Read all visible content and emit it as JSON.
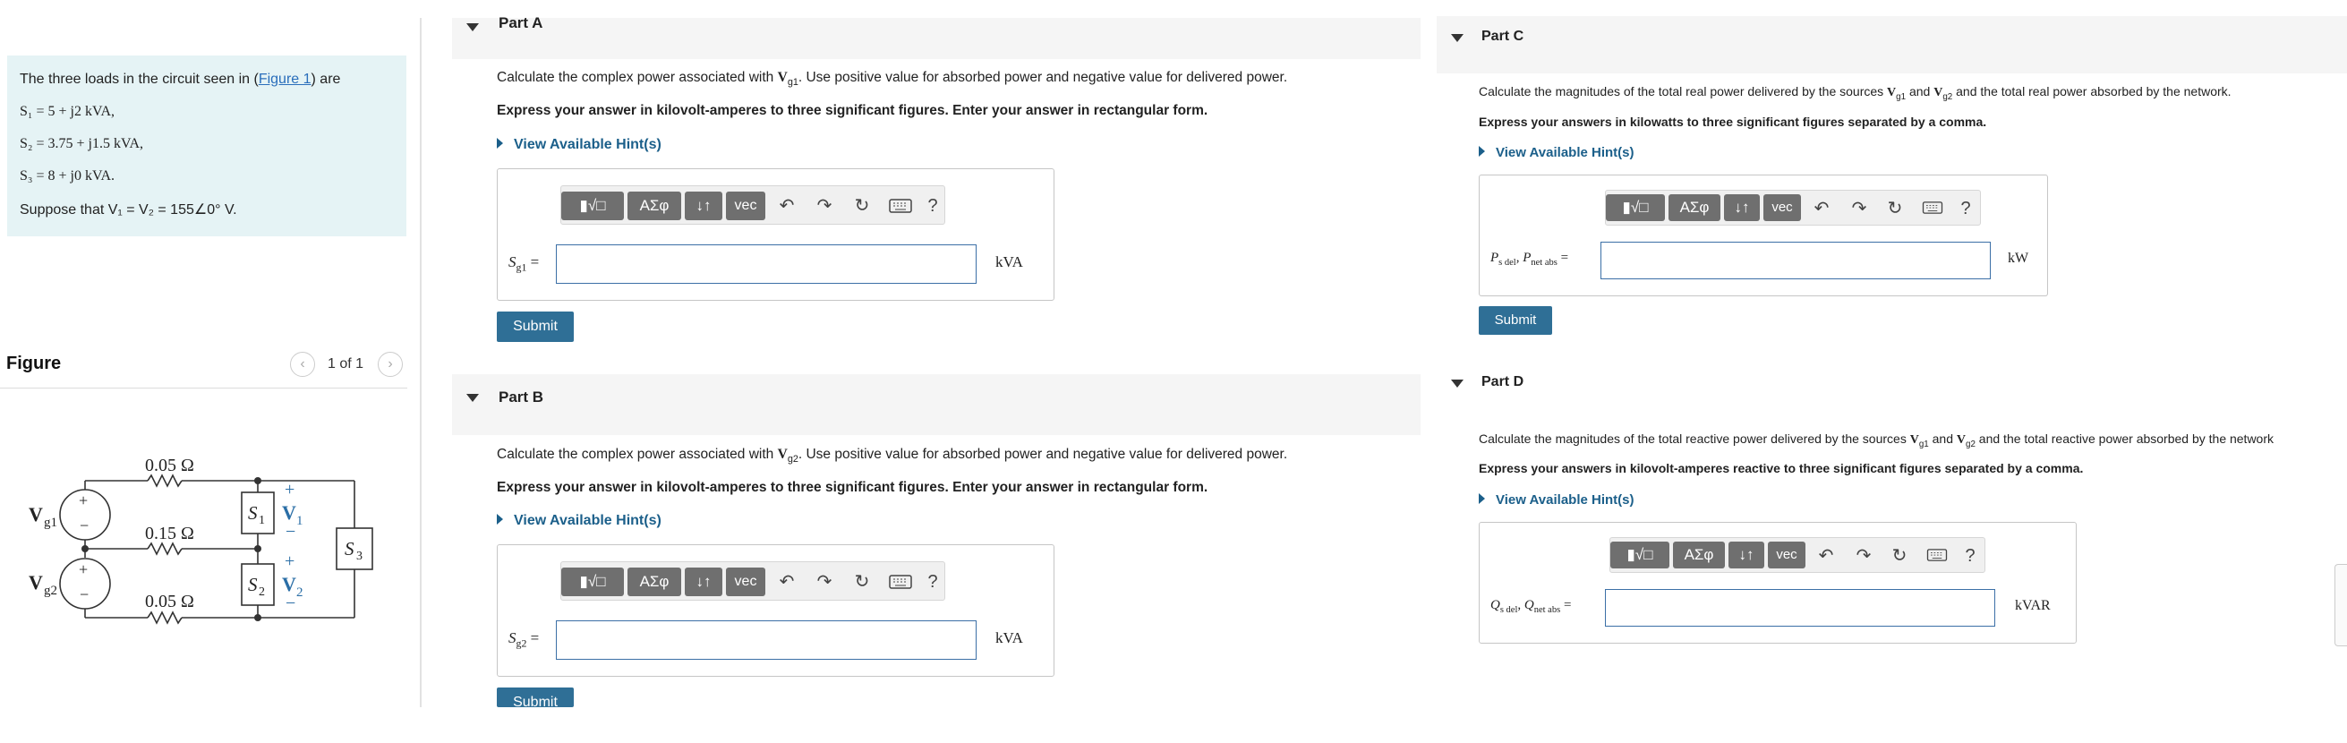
{
  "problem": {
    "intro_prefix": "The three loads in the circuit seen in (",
    "figure_link": "Figure 1",
    "intro_suffix": ") are",
    "s1": "S₁ = 5 + j2 kVA,",
    "s2": "S₂ = 3.75 + j1.5 kVA,",
    "s3": "S₃ = 8 + j0 kVA.",
    "suppose": "Suppose that V₁ = V₂ = 155∠0° V."
  },
  "figure": {
    "title": "Figure",
    "pager": "1 of 1",
    "prev_icon": "chevron-left-icon",
    "next_icon": "chevron-right-icon",
    "circuit": {
      "r_top": "0.05 Ω",
      "r_mid": "0.15 Ω",
      "r_bot": "0.05 Ω",
      "vg1": "V",
      "vg1_sub": "g1",
      "vg2": "V",
      "vg2_sub": "g2",
      "s1": "S",
      "s1_sub": "1",
      "s2": "S",
      "s2_sub": "2",
      "s3": "S",
      "s3_sub": "3",
      "v1": "V",
      "v1_sub": "1",
      "v2": "V",
      "v2_sub": "2",
      "plus": "+",
      "minus": "−"
    }
  },
  "toolbar": {
    "template_icon": "fraction-root-template-icon",
    "greek": "AΣφ",
    "arrows": "↓↑",
    "vec": "vec",
    "undo_icon": "↶",
    "redo_icon": "↷",
    "reset_icon": "↻",
    "keyboard_icon": "keyboard-icon",
    "help": "?"
  },
  "partA": {
    "title": "Part A",
    "q_prefix": "Calculate the complex power associated with ",
    "q_var": "V",
    "q_sub": "g1",
    "q_suffix": ". Use positive value for absorbed power and negative value for delivered power.",
    "instruction": "Express your answer in kilovolt-amperes to three significant figures. Enter your answer in rectangular form.",
    "hint": "View Available Hint(s)",
    "label": "S",
    "label_sub": "g1",
    "label_eq": " =",
    "unit": "kVA",
    "input_value": "",
    "submit": "Submit"
  },
  "partB": {
    "title": "Part B",
    "q_prefix": "Calculate the complex power associated with ",
    "q_var": "V",
    "q_sub": "g2",
    "q_suffix": ". Use positive value for absorbed power and negative value for delivered power.",
    "instruction": "Express your answer in kilovolt-amperes to three significant figures. Enter your answer in rectangular form.",
    "hint": "View Available Hint(s)",
    "label": "S",
    "label_sub": "g2",
    "label_eq": " =",
    "unit": "kVA",
    "input_value": "",
    "submit": "Submit"
  },
  "partC": {
    "title": "Part C",
    "q_prefix": "Calculate the magnitudes of the total real power delivered by the sources ",
    "q_v1": "V",
    "q_v1_sub": "g1",
    "q_and": " and ",
    "q_v2": "V",
    "q_v2_sub": "g2",
    "q_suffix": " and the total real power absorbed by the network.",
    "instruction": "Express your answers in kilowatts to three significant figures separated by a comma.",
    "hint": "View Available Hint(s)",
    "label_a": "P",
    "label_a_sub": "s del",
    "label_b": "P",
    "label_b_sub": "net abs",
    "label_eq": " =",
    "unit": "kW",
    "input_value": "",
    "submit": "Submit"
  },
  "partD": {
    "title": "Part D",
    "q_prefix": "Calculate the magnitudes of the total reactive power delivered by the sources ",
    "q_v1": "V",
    "q_v1_sub": "g1",
    "q_and": " and ",
    "q_v2": "V",
    "q_v2_sub": "g2",
    "q_suffix": " and the total reactive power absorbed by the network",
    "instruction": "Express your answers in kilovolt-amperes reactive to three significant figures separated by a comma.",
    "hint": "View Available Hint(s)",
    "label_a": "Q",
    "label_a_sub": "s del",
    "label_b": "Q",
    "label_b_sub": "net abs",
    "label_eq": " =",
    "unit": "kVAR",
    "input_value": ""
  }
}
